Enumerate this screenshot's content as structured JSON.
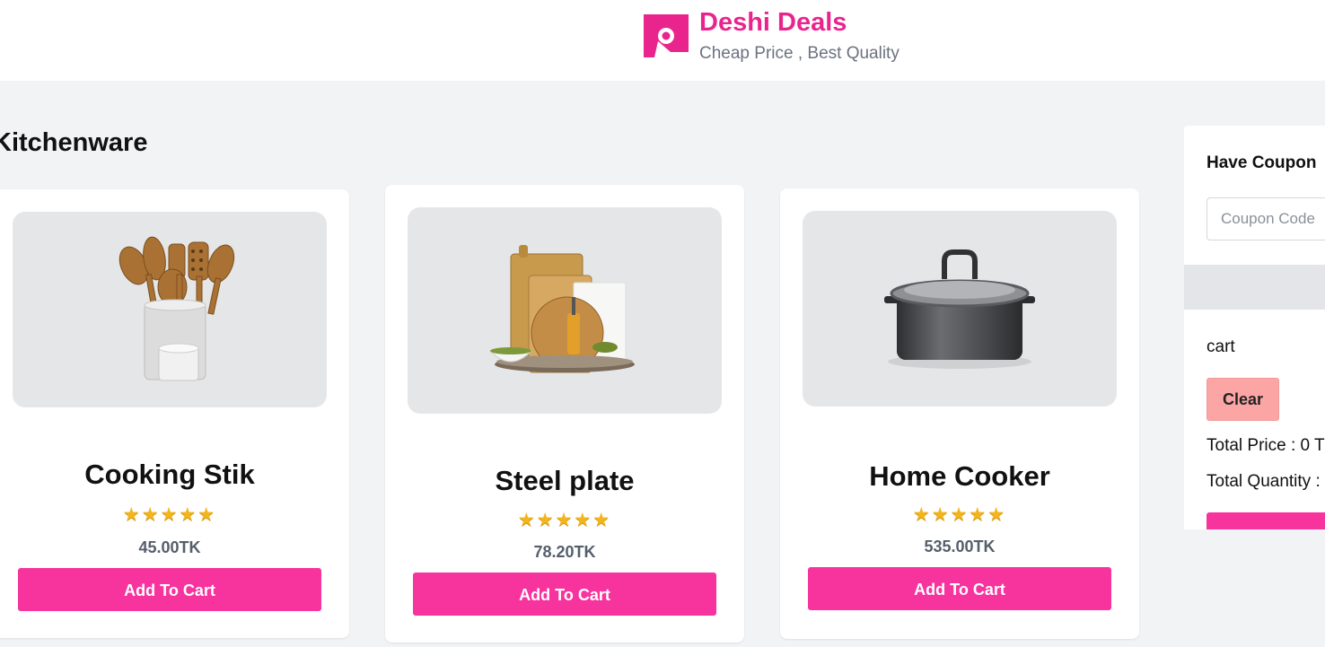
{
  "header": {
    "brand_title": "Deshi Deals",
    "tagline": "Cheap Price , Best Quality",
    "logo_icon": "shopping-tag-icon",
    "brand_color": "#e9258d"
  },
  "main": {
    "section_title": "Kitchenware",
    "products": [
      {
        "name": "Cooking Stik",
        "rating": 5,
        "stars": "★★★★★",
        "price": "45.00TK",
        "button": "Add To Cart",
        "image_icon": "utensil-holder-icon"
      },
      {
        "name": "Steel plate",
        "rating": 5,
        "stars": "★★★★★",
        "price": "78.20TK",
        "button": "Add To Cart",
        "image_icon": "cutting-boards-icon"
      },
      {
        "name": "Home Cooker",
        "rating": 5,
        "stars": "★★★★★",
        "price": "535.00TK",
        "button": "Add To Cart",
        "image_icon": "cooking-pot-icon"
      }
    ]
  },
  "sidebar": {
    "coupon_title": "Have Coupon",
    "coupon_placeholder": "Coupon Code",
    "cart_label": "cart",
    "clear_button": "Clear",
    "total_price": "Total Price : 0 T",
    "total_quantity": "Total Quantity :"
  },
  "colors": {
    "accent": "#f7339e",
    "clear_button": "#fca5a5",
    "page_background": "#f2f3f5",
    "star": "#f3b51c"
  }
}
